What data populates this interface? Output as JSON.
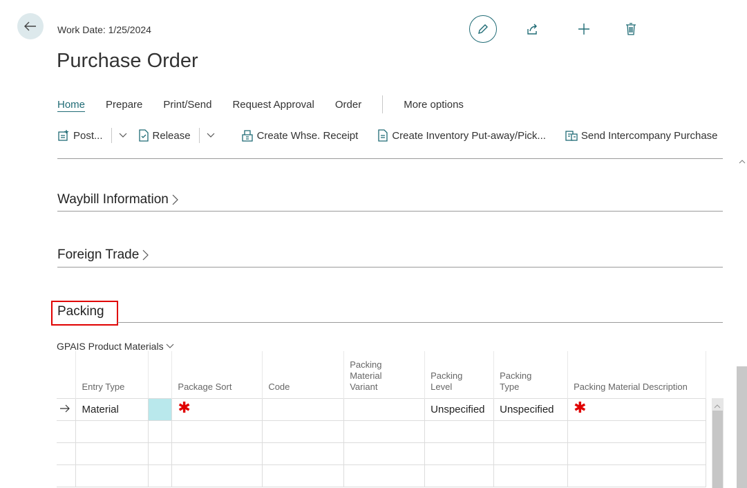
{
  "header": {
    "work_date": "Work Date: 1/25/2024",
    "title": "Purchase Order"
  },
  "tabs": [
    {
      "label": "Home",
      "active": true
    },
    {
      "label": "Prepare"
    },
    {
      "label": "Print/Send"
    },
    {
      "label": "Request Approval"
    },
    {
      "label": "Order"
    },
    {
      "label": "More options"
    }
  ],
  "actions": {
    "post": "Post...",
    "release": "Release",
    "create_whse_receipt": "Create Whse. Receipt",
    "create_inventory": "Create Inventory Put-away/Pick...",
    "send_intercompany": "Send Intercompany Purchase"
  },
  "sections": {
    "waybill": "Waybill Information",
    "foreign_trade": "Foreign Trade",
    "packing": "Packing"
  },
  "subpart": {
    "title": "GPAIS Product Materials",
    "columns": {
      "entry_type": "Entry Type",
      "package_sort": "Package Sort",
      "code": "Code",
      "pm_variant_1": "Packing",
      "pm_variant_2": "Material",
      "pm_variant_3": "Variant",
      "level_1": "Packing",
      "level_2": "Level",
      "type_1": "Packing",
      "type_2": "Type",
      "description": "Packing Material Description"
    },
    "row": {
      "entry_type": "Material",
      "packing_level": "Unspecified",
      "packing_type": "Unspecified"
    }
  },
  "colors": {
    "accent": "#1f6b75",
    "required": "#e00000"
  }
}
